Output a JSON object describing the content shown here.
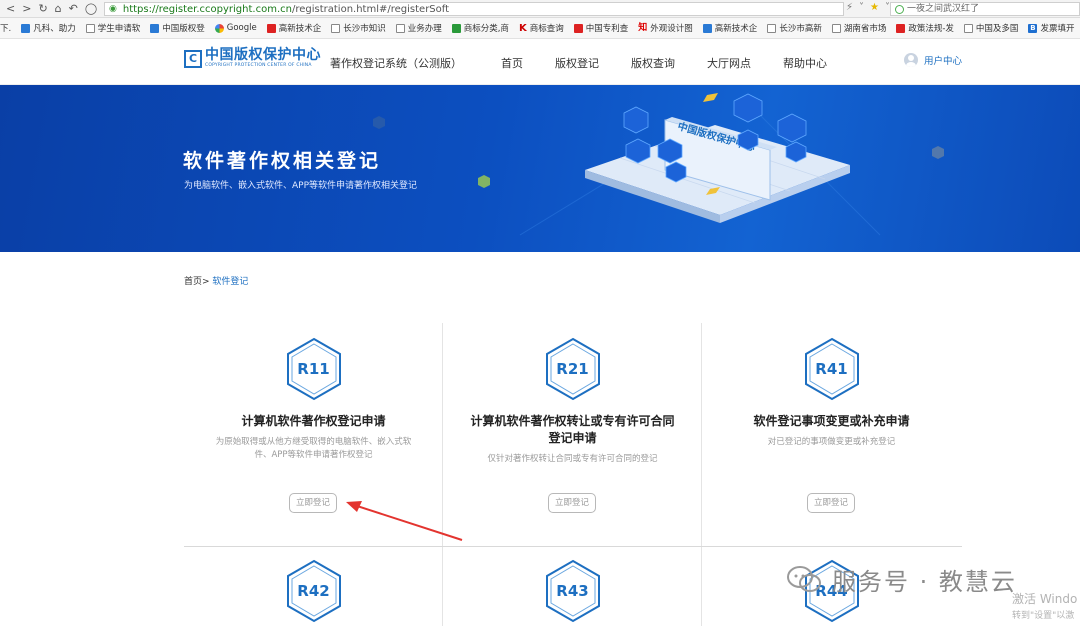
{
  "browser": {
    "url_host": "https://register.ccopyright.com.cn",
    "url_path": "/registration.html#/registerSoft",
    "search_text": "一夜之间武汉红了",
    "bookmarks": [
      {
        "label": "下.",
        "icon": "none"
      },
      {
        "label": "凡科、助力",
        "icon": "blue"
      },
      {
        "label": "学生申请软",
        "icon": "page"
      },
      {
        "label": "中国版权登",
        "icon": "blue"
      },
      {
        "label": "Google",
        "icon": "g"
      },
      {
        "label": "高新技术企",
        "icon": "red"
      },
      {
        "label": "长沙市知识",
        "icon": "page"
      },
      {
        "label": "业务办理",
        "icon": "page"
      },
      {
        "label": "商标分类,商",
        "icon": "green"
      },
      {
        "label": "商标查询",
        "icon": "k"
      },
      {
        "label": "中国专利查",
        "icon": "red"
      },
      {
        "label": "外观设计图",
        "icon": "zhi"
      },
      {
        "label": "高新技术企",
        "icon": "blue"
      },
      {
        "label": "长沙市高新",
        "icon": "page"
      },
      {
        "label": "湖南省市场",
        "icon": "page"
      },
      {
        "label": "政策法规-发",
        "icon": "red"
      },
      {
        "label": "中国及多国",
        "icon": "page"
      },
      {
        "label": "发票填开",
        "icon": "b"
      },
      {
        "label": "国家知识产",
        "icon": "page"
      }
    ]
  },
  "header": {
    "logo_cn": "中国版权保护中心",
    "logo_en": "COPYRIGHT PROTECTION CENTER OF CHINA",
    "system_name": "著作权登记系统（公测版）",
    "nav": [
      "首页",
      "版权登记",
      "版权查询",
      "大厅网点",
      "帮助中心"
    ],
    "user_center": "用户中心"
  },
  "banner": {
    "title": "软件著作权相关登记",
    "subtitle": "为电脑软件、嵌入式软件、APP等软件申请著作权相关登记",
    "illustration_label": "中国版权保护中心"
  },
  "breadcrumb": {
    "home": "首页>",
    "current": "软件登记"
  },
  "cards": [
    {
      "code": "R11",
      "title": "计算机软件著作权登记申请",
      "desc": "为原始取得或从他方继受取得的电脑软件、嵌入式软件、APP等软件申请著作权登记",
      "button": "立即登记"
    },
    {
      "code": "R21",
      "title": "计算机软件著作权转让或专有许可合同登记申请",
      "desc": "仅针对著作权转让合同或专有许可合同的登记",
      "button": "立即登记"
    },
    {
      "code": "R41",
      "title": "软件登记事项变更或补充申请",
      "desc": "对已登记的事项做变更或补充登记",
      "button": "立即登记"
    },
    {
      "code": "R42"
    },
    {
      "code": "R43"
    },
    {
      "code": "R44"
    }
  ],
  "watermark": {
    "text": "服务号 · 教慧云",
    "activate": "激活 Windo",
    "activate_sub": "转到\"设置\"以激"
  },
  "colors": {
    "brand_blue": "#1d6fc1",
    "banner_blue": "#0c4fc0",
    "arrow_red": "#e3342f"
  }
}
